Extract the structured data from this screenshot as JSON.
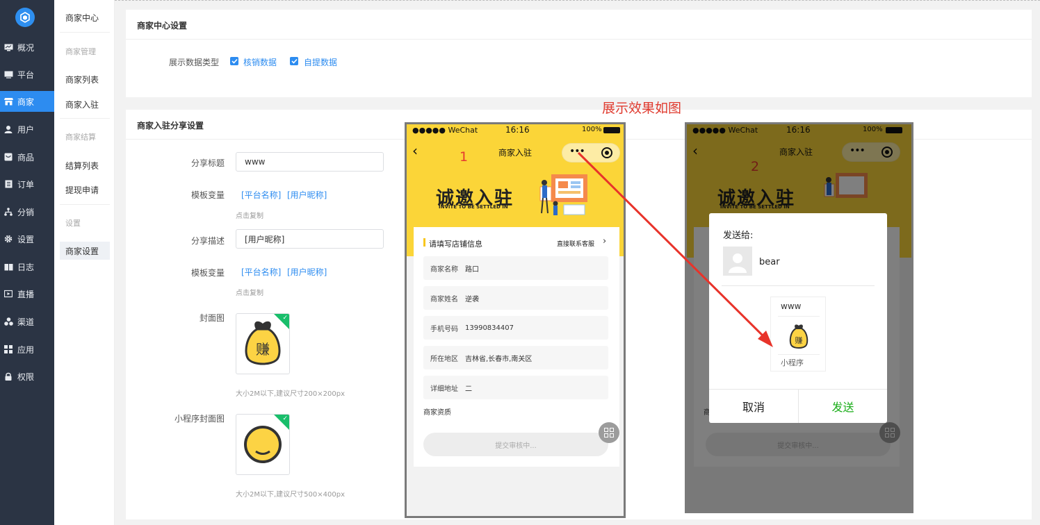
{
  "sidebar": {
    "items": [
      {
        "label": "概况",
        "icon": "monitor-icon"
      },
      {
        "label": "平台",
        "icon": "desktop-icon"
      },
      {
        "label": "商家",
        "icon": "store-icon"
      },
      {
        "label": "用户",
        "icon": "user-icon"
      },
      {
        "label": "商品",
        "icon": "goods-icon"
      },
      {
        "label": "订单",
        "icon": "order-icon"
      },
      {
        "label": "分销",
        "icon": "share-tree-icon"
      },
      {
        "label": "设置",
        "icon": "gear-icon"
      },
      {
        "label": "日志",
        "icon": "book-icon"
      },
      {
        "label": "直播",
        "icon": "live-icon"
      },
      {
        "label": "渠道",
        "icon": "channel-icon"
      },
      {
        "label": "应用",
        "icon": "apps-grid-icon"
      },
      {
        "label": "权限",
        "icon": "lock-icon"
      }
    ],
    "active_index": 2
  },
  "subnav": {
    "title": "商家中心",
    "group1": "商家管理",
    "item_list": "商家列表",
    "item_join": "商家入驻",
    "group2": "商家结算",
    "item_settle": "结算列表",
    "item_withdraw": "提现申请",
    "group3": "设置",
    "item_settings": "商家设置"
  },
  "card1": {
    "title": "商家中心设置",
    "label": "展示数据类型",
    "opt1": "核销数据",
    "opt2": "自提数据"
  },
  "card2": {
    "title": "商家入驻分享设置",
    "share_title_label": "分享标题",
    "share_title_value": "www",
    "tpl_label": "模板变量",
    "var1": "[平台名称]",
    "var2": "[用户昵称]",
    "copy_hint": "点击复制",
    "share_desc_label": "分享描述",
    "share_desc_value": "[用户昵称]",
    "cover_label": "封面图",
    "cover_hint": "大小2M以下,建议尺寸200×200px",
    "mini_cover_label": "小程序封面图",
    "mini_cover_hint": "大小2M以下,建议尺寸500×400px"
  },
  "preview": {
    "title": "展示效果如图",
    "phone1_num": "1",
    "phone2_num": "2"
  },
  "phone": {
    "carrier": "●●●●● WeChat",
    "time": "16:16",
    "battery": "100%",
    "nav_title": "商家入驻",
    "banner_cn": "诚邀入驻",
    "banner_en": "INVITE TO BE SETTLED IN",
    "section": "请填写店铺信息",
    "contact": "直接联系客服",
    "fields": [
      {
        "label": "商家名称",
        "value": "路口"
      },
      {
        "label": "商家姓名",
        "value": "逆袭"
      },
      {
        "label": "手机号码",
        "value": "13990834407"
      },
      {
        "label": "所在地区",
        "value": "吉林省,长春市,南关区"
      },
      {
        "label": "详细地址",
        "value": "二"
      }
    ],
    "qualification": "商家资质",
    "submit": "提交审核中..."
  },
  "dialog": {
    "send_to": "发送给:",
    "user": "bear",
    "card_title": "www",
    "card_footer": "小程序",
    "cancel": "取消",
    "send": "发送",
    "send_color": "#1aad19"
  },
  "colors": {
    "accent": "#2d8cf0",
    "sidebar_bg": "#2b3444",
    "phone_yellow": "#fbd538",
    "arrow_red": "#e8332a"
  }
}
